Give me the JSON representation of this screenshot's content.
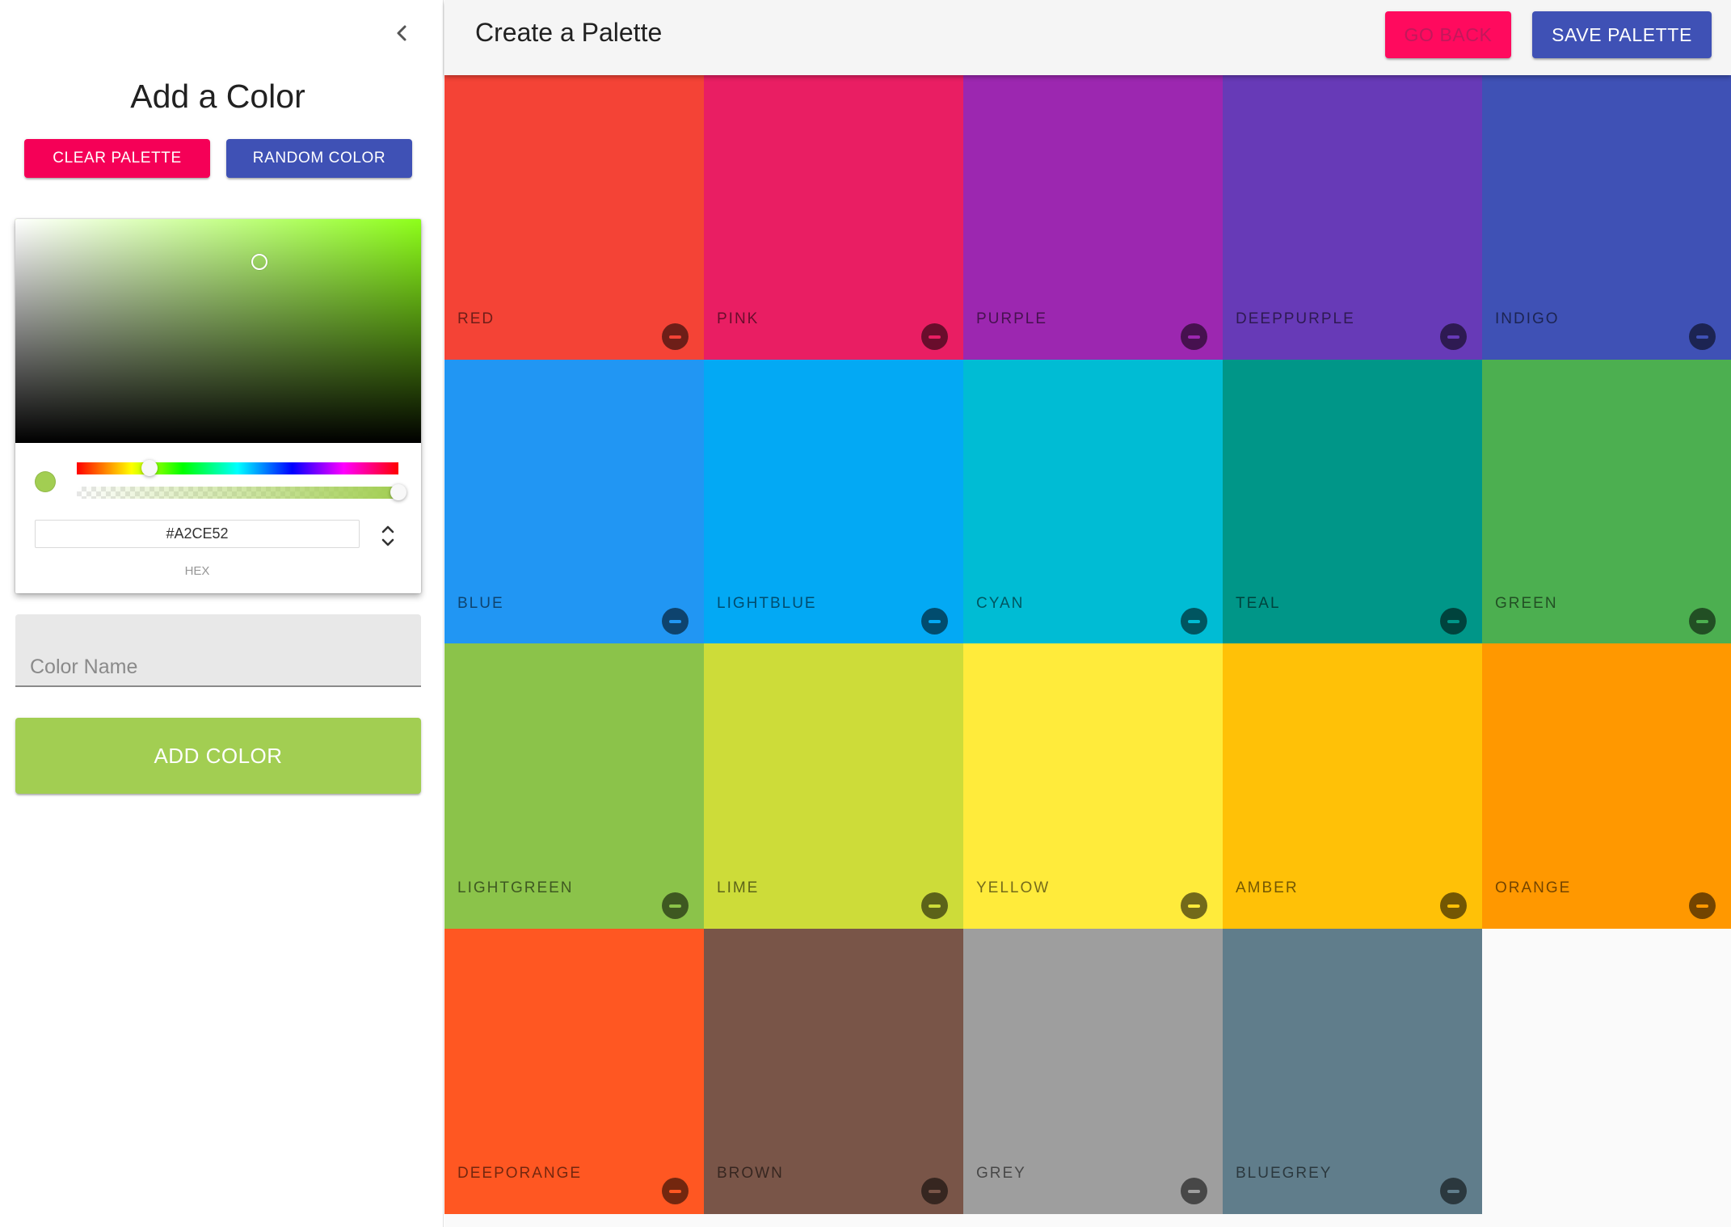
{
  "drawer": {
    "title": "Add a Color",
    "clear_label": "CLEAR PALETTE",
    "random_label": "RANDOM COLOR"
  },
  "picker": {
    "current_color": "#A2CE52",
    "hex_value": "#A2CE52",
    "mode_label": "HEX",
    "hue_degrees": 82,
    "alpha": 1.0
  },
  "form": {
    "name_placeholder": "Color Name",
    "add_label": "ADD COLOR",
    "add_color": "#a2ce52"
  },
  "appbar": {
    "title": "Create a Palette",
    "back_label": "GO BACK",
    "save_label": "SAVE PALETTE"
  },
  "colors": [
    {
      "name": "RED",
      "hex": "#f44336"
    },
    {
      "name": "PINK",
      "hex": "#e91e63"
    },
    {
      "name": "PURPLE",
      "hex": "#9c27b0"
    },
    {
      "name": "DEEPPURPLE",
      "hex": "#673ab7"
    },
    {
      "name": "INDIGO",
      "hex": "#3f51b5"
    },
    {
      "name": "BLUE",
      "hex": "#2196f3"
    },
    {
      "name": "LIGHTBLUE",
      "hex": "#03a9f4"
    },
    {
      "name": "CYAN",
      "hex": "#00bcd4"
    },
    {
      "name": "TEAL",
      "hex": "#009688"
    },
    {
      "name": "GREEN",
      "hex": "#4caf50"
    },
    {
      "name": "LIGHTGREEN",
      "hex": "#8bc34a"
    },
    {
      "name": "LIME",
      "hex": "#cddc39"
    },
    {
      "name": "YELLOW",
      "hex": "#ffeb3b"
    },
    {
      "name": "AMBER",
      "hex": "#ffc107"
    },
    {
      "name": "ORANGE",
      "hex": "#ff9800"
    },
    {
      "name": "DEEPORANGE",
      "hex": "#ff5722"
    },
    {
      "name": "BROWN",
      "hex": "#795548"
    },
    {
      "name": "GREY",
      "hex": "#9e9e9e"
    },
    {
      "name": "BLUEGREY",
      "hex": "#607d8b"
    }
  ]
}
